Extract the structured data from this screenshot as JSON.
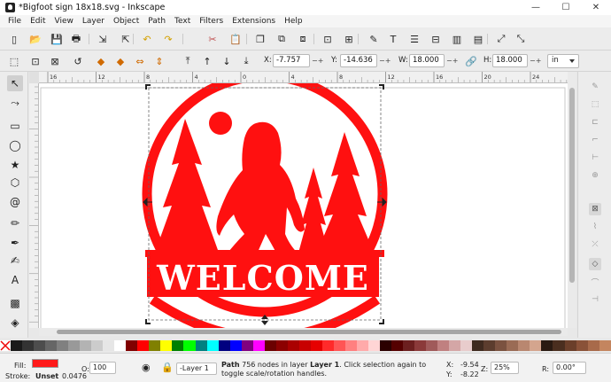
{
  "window": {
    "title": "*Bigfoot sign 18x18.svg - Inkscape",
    "controls": [
      "—",
      "☐",
      "✕"
    ]
  },
  "menu": [
    "File",
    "Edit",
    "View",
    "Layer",
    "Object",
    "Path",
    "Text",
    "Filters",
    "Extensions",
    "Help"
  ],
  "command_icons": [
    {
      "name": "new-document-icon",
      "glyph": "▯"
    },
    {
      "name": "open-file-icon",
      "glyph": "📂"
    },
    {
      "name": "save-icon",
      "glyph": "💾"
    },
    {
      "name": "print-icon",
      "glyph": "🖶"
    },
    {
      "name": "import-icon",
      "glyph": "⇲"
    },
    {
      "name": "export-icon",
      "glyph": "⇱"
    },
    {
      "name": "undo-icon",
      "glyph": "↶"
    },
    {
      "name": "redo-icon",
      "glyph": "↷"
    },
    {
      "name": "cut-icon",
      "glyph": "✂"
    },
    {
      "name": "paste-icon",
      "glyph": "📋"
    },
    {
      "name": "duplicate-icon",
      "glyph": "❐"
    },
    {
      "name": "clone-icon",
      "glyph": "⧉"
    },
    {
      "name": "unlink-clone-icon",
      "glyph": "⧈"
    },
    {
      "name": "group-icon",
      "glyph": "⊡"
    },
    {
      "name": "ungroup-icon",
      "glyph": "⊞"
    },
    {
      "name": "fill-stroke-icon",
      "glyph": "✎"
    },
    {
      "name": "text-font-icon",
      "glyph": "T"
    },
    {
      "name": "layers-icon",
      "glyph": "☰"
    },
    {
      "name": "xml-editor-icon",
      "glyph": "⊟"
    },
    {
      "name": "align-distribute-icon",
      "glyph": "▥"
    },
    {
      "name": "preferences-icon",
      "glyph": "▤"
    },
    {
      "name": "zoom-tool-icon",
      "glyph": "⤢"
    },
    {
      "name": "node-edit-icon",
      "glyph": "⤡"
    }
  ],
  "controls": {
    "x_label": "X:",
    "x_value": "-7.757",
    "y_label": "Y:",
    "y_value": "-14.636",
    "w_label": "W:",
    "w_value": "18.000",
    "h_label": "H:",
    "h_value": "18.000",
    "unit": "in"
  },
  "ruler_marks": [
    "16",
    "12",
    "8",
    "4",
    "0",
    "4",
    "8",
    "12",
    "16",
    "20",
    "24"
  ],
  "tools": [
    {
      "name": "selector-tool-icon",
      "glyph": "↖",
      "active": true
    },
    {
      "name": "node-tool-icon",
      "glyph": "⤳"
    },
    {
      "name": "rectangle-tool-icon",
      "glyph": "▭"
    },
    {
      "name": "ellipse-tool-icon",
      "glyph": "◯"
    },
    {
      "name": "star-tool-icon",
      "glyph": "★"
    },
    {
      "name": "3d-box-tool-icon",
      "glyph": "⬡"
    },
    {
      "name": "spiral-tool-icon",
      "glyph": "@"
    },
    {
      "name": "pencil-tool-icon",
      "glyph": "✏"
    },
    {
      "name": "pen-tool-icon",
      "glyph": "✒"
    },
    {
      "name": "calligraphy-tool-icon",
      "glyph": "✍"
    },
    {
      "name": "text-tool-icon",
      "glyph": "A"
    },
    {
      "name": "spray-tool-icon",
      "glyph": "▩"
    },
    {
      "name": "eraser-tool-icon",
      "glyph": "◈"
    }
  ],
  "artwork": {
    "welcome_text": "WELCOME",
    "color": "#ff1010"
  },
  "palette": [
    "#1a1a1a",
    "#333333",
    "#4d4d4d",
    "#666666",
    "#808080",
    "#999999",
    "#b3b3b3",
    "#cccccc",
    "#e6e6e6",
    "#ffffff",
    "#800000",
    "#ff0000",
    "#808000",
    "#ffff00",
    "#008000",
    "#00ff00",
    "#008080",
    "#00ffff",
    "#000080",
    "#0000ff",
    "#800080",
    "#ff00ff",
    "#6b0000",
    "#8c0000",
    "#aa0000",
    "#c80000",
    "#e60000",
    "#ff2a2a",
    "#ff5555",
    "#ff8080",
    "#ffaaaa",
    "#ffd5d5",
    "#2b0000",
    "#550000",
    "#6c1f1f",
    "#8b3a3a",
    "#a05a5a",
    "#c08080",
    "#d4a6a6",
    "#e8cccc",
    "#3f2a1f",
    "#5c3d2e",
    "#7b5240",
    "#9a6b55",
    "#b98770",
    "#d4a58e",
    "#2a1a12",
    "#4a2e1f",
    "#6b3f2a",
    "#8a5238",
    "#a86a4a",
    "#c4855f"
  ],
  "status": {
    "fill_label": "Fill:",
    "stroke_label": "Stroke:",
    "stroke_value": "Unset",
    "stroke_width": "0.0476",
    "opacity_label": "O:",
    "opacity_value": "100",
    "layer": "-Layer 1",
    "message_bold1": "Path",
    "message_part1": " 756 nodes in layer ",
    "message_bold2": "Layer 1",
    "message_part2": ". Click selection again to toggle scale/rotation handles.",
    "x_label": "X:",
    "x_value": "-9.54",
    "y_label": "Y:",
    "y_value": "-8.22",
    "zoom_label": "Z:",
    "zoom_value": "25%",
    "rotation_label": "R:",
    "rotation_value": "0.00°"
  }
}
